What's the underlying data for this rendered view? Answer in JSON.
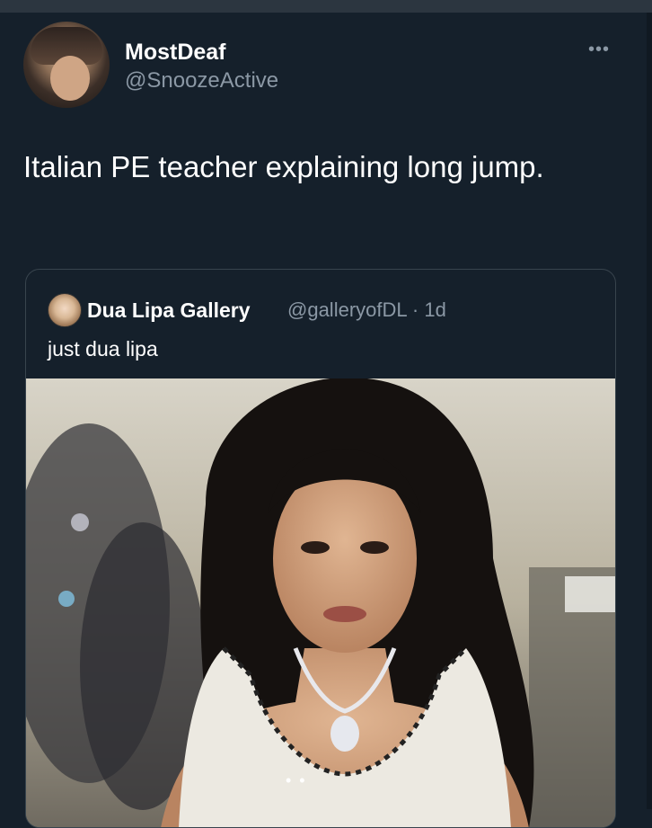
{
  "tweet": {
    "author_name": "MostDeaf",
    "author_handle": "@SnoozeActive",
    "more_icon": "more-dots-icon",
    "text": "Italian PE teacher explaining long jump."
  },
  "quoted_tweet": {
    "author_name": "Dua Lipa Gallery",
    "meta": "@galleryofDL · 1d",
    "text": "just dua lipa",
    "image_indicator": "• •"
  },
  "colors": {
    "background": "#15202b",
    "secondary_text": "#8b98a5",
    "border": "#38444d"
  }
}
